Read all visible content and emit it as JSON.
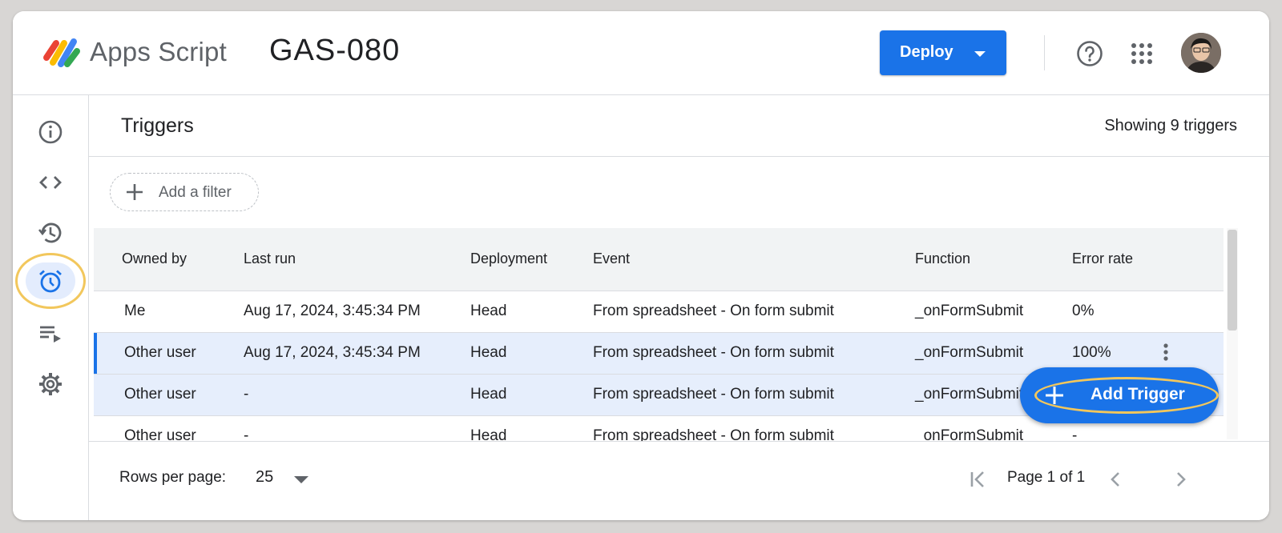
{
  "header": {
    "app_name": "Apps Script",
    "project_name": "GAS-080",
    "deploy_label": "Deploy",
    "icons": [
      "apps-script-logo",
      "help-icon",
      "apps-grid-icon",
      "avatar"
    ]
  },
  "sidebar": {
    "items": [
      {
        "name": "overview",
        "icon": "info-icon"
      },
      {
        "name": "editor",
        "icon": "code-icon"
      },
      {
        "name": "executions-history",
        "icon": "history-icon"
      },
      {
        "name": "triggers",
        "icon": "alarm-clock-icon",
        "active": true
      },
      {
        "name": "executions",
        "icon": "playlist-play-icon"
      },
      {
        "name": "settings",
        "icon": "gear-icon"
      }
    ]
  },
  "main": {
    "title": "Triggers",
    "count_text": "Showing 9 triggers",
    "filter_label": "Add a filter",
    "columns": [
      "Owned by",
      "Last run",
      "Deployment",
      "Event",
      "Function",
      "Error rate"
    ],
    "rows": [
      {
        "owner": "Me",
        "last_run": "Aug 17, 2024, 3:45:34 PM",
        "deployment": "Head",
        "event": "From spreadsheet - On form submit",
        "function": "_onFormSubmit",
        "error_rate": "0%"
      },
      {
        "owner": "Other user",
        "last_run": "Aug 17, 2024, 3:45:34 PM",
        "deployment": "Head",
        "event": "From spreadsheet - On form submit",
        "function": "_onFormSubmit",
        "error_rate": "100%"
      },
      {
        "owner": "Other user",
        "last_run": "-",
        "deployment": "Head",
        "event": "From spreadsheet - On form submit",
        "function": "_onFormSubmit",
        "error_rate": ""
      },
      {
        "owner": "Other user",
        "last_run": "-",
        "deployment": "Head",
        "event": "From spreadsheet - On form submit",
        "function": "_onFormSubmit",
        "error_rate": "-"
      }
    ],
    "add_trigger_label": "Add Trigger"
  },
  "footer": {
    "rows_per_page_label": "Rows per page:",
    "rows_per_page_value": "25",
    "page_text": "Page 1 of 1"
  },
  "colors": {
    "accent": "#1a73e8",
    "highlight_ring": "#f2c75c",
    "selected_row": "#e6eefc"
  }
}
